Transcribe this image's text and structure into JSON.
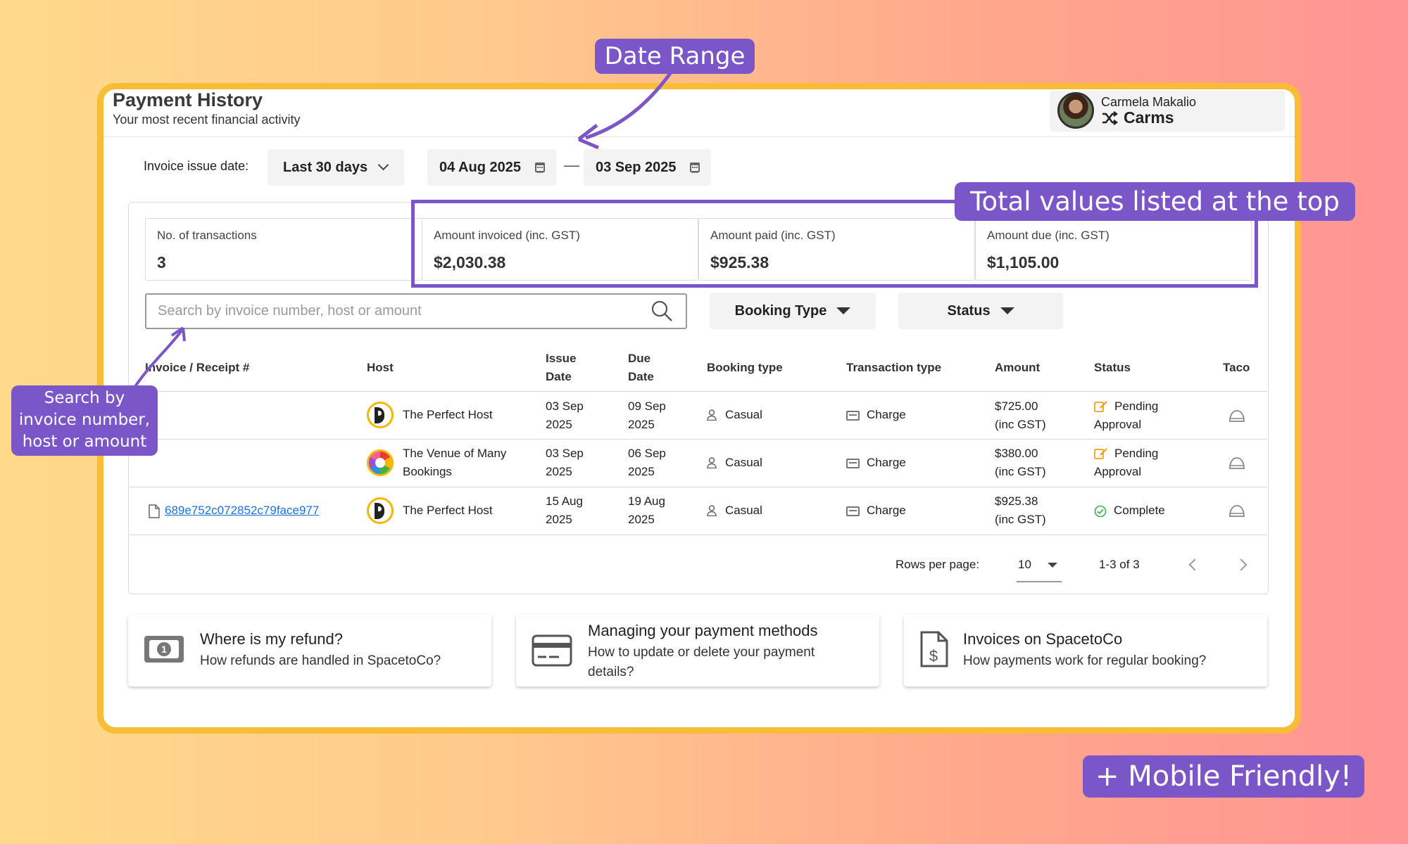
{
  "header": {
    "title": "Payment History",
    "subtitle": "Your most recent financial activity"
  },
  "user": {
    "full_name": "Carmela Makalio",
    "short_name": "Carms"
  },
  "filters": {
    "issue_label": "Invoice issue date:",
    "range": "Last 30 days",
    "start_date": "04 Aug 2025",
    "end_date": "03 Sep 2025",
    "separator": "—"
  },
  "stats": [
    {
      "label": "No. of transactions",
      "value": "3"
    },
    {
      "label": "Amount invoiced (inc. GST)",
      "value": "$2,030.38"
    },
    {
      "label": "Amount paid (inc. GST)",
      "value": "$925.38"
    },
    {
      "label": "Amount due (inc. GST)",
      "value": "$1,105.00"
    }
  ],
  "search": {
    "placeholder": "Search by invoice number, host or amount"
  },
  "filter_buttons": {
    "booking_type": "Booking Type",
    "status": "Status"
  },
  "table": {
    "headers": {
      "invoice": "Invoice / Receipt #",
      "host": "Host",
      "issue_date": [
        "Issue",
        "Date"
      ],
      "due_date": [
        "Due",
        "Date"
      ],
      "booking_type": "Booking type",
      "transaction_type": "Transaction type",
      "amount": "Amount",
      "status": "Status",
      "taco": "Taco"
    },
    "rows": [
      {
        "invoice": "",
        "host": "The Perfect Host",
        "host_lines": [
          "The Perfect Host"
        ],
        "issue": [
          "03 Sep",
          "2025"
        ],
        "due": [
          "09 Sep",
          "2025"
        ],
        "booking": "Casual",
        "transaction": "Charge",
        "amount": [
          "$725.00",
          "(inc GST)"
        ],
        "status": [
          "Pending",
          "Approval"
        ],
        "status_icon": "pending-icon"
      },
      {
        "invoice": "",
        "host": "The Venue of Many Bookings",
        "host_lines": [
          "The Venue of Many",
          "Bookings"
        ],
        "issue": [
          "03 Sep",
          "2025"
        ],
        "due": [
          "06 Sep",
          "2025"
        ],
        "booking": "Casual",
        "transaction": "Charge",
        "amount": [
          "$380.00",
          "(inc GST)"
        ],
        "status": [
          "Pending",
          "Approval"
        ],
        "status_icon": "pending-icon"
      },
      {
        "invoice": "689e752c072852c79face977",
        "host": "The Perfect Host",
        "host_lines": [
          "The Perfect Host"
        ],
        "issue": [
          "15 Aug",
          "2025"
        ],
        "due": [
          "19 Aug",
          "2025"
        ],
        "booking": "Casual",
        "transaction": "Charge",
        "amount": [
          "$925.38",
          "(inc GST)"
        ],
        "status": [
          "Complete"
        ],
        "status_icon": "check-circle-icon"
      }
    ]
  },
  "pagination": {
    "rows_label": "Rows per page:",
    "rows_value": "10",
    "range": "1-3 of 3"
  },
  "help_cards": [
    {
      "title": "Where is my refund?",
      "subtitle": "How refunds are handled in SpacetoCo?",
      "icon": "cash-icon"
    },
    {
      "title": "Managing your payment methods",
      "subtitle": "How to update or delete your payment details?",
      "icon": "credit-card-icon"
    },
    {
      "title": "Invoices on SpacetoCo",
      "subtitle": "How payments work for regular booking?",
      "icon": "invoice-icon"
    }
  ],
  "annotations": {
    "date_range": "Date Range",
    "totals": "Total values listed at the top",
    "search": [
      "Search by",
      "invoice number,",
      "host or amount"
    ],
    "mobile": "+ Mobile Friendly!"
  },
  "colors": {
    "frame": "#f9bd35",
    "annotation": "#7a56c8",
    "link": "#1a73e8",
    "pending": "#f0a020",
    "complete": "#3bb54a"
  }
}
